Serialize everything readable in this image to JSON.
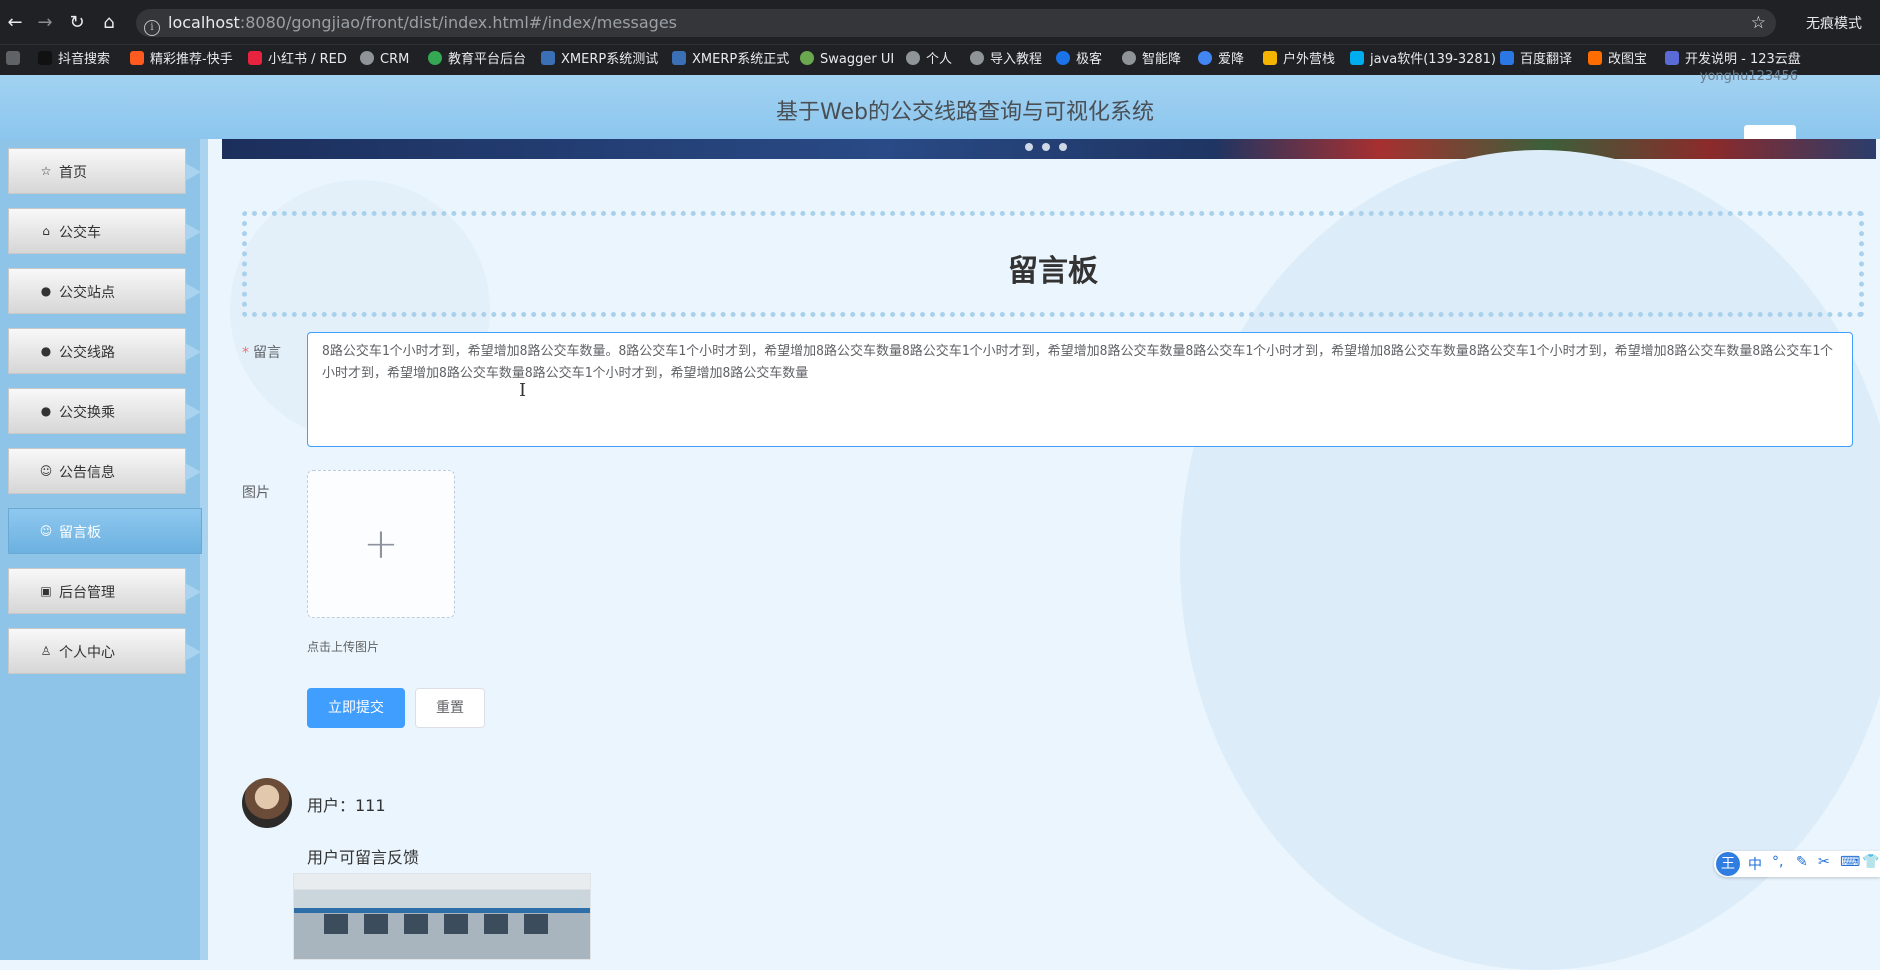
{
  "browser": {
    "url_host": "localhost",
    "url_rest": ":8080/gongjiao/front/dist/index.html#/index/messages",
    "incognito_label": "无痕模式",
    "bookmarks": [
      {
        "label": "抖音搜索",
        "color": "#111111"
      },
      {
        "label": "精彩推荐-快手",
        "color": "#ff5a1f"
      },
      {
        "label": "小红书 / RED",
        "color": "#e8233f"
      },
      {
        "label": "CRM",
        "color": "#5f6368"
      },
      {
        "label": "教育平台后台",
        "color": "#34a853"
      },
      {
        "label": "XMERP系统测试",
        "color": "#3b6fb6"
      },
      {
        "label": "XMERP系统正式",
        "color": "#3b6fb6"
      },
      {
        "label": "Swagger UI",
        "color": "#6aa84f"
      },
      {
        "label": "个人",
        "color": "#5f6368"
      },
      {
        "label": "导入教程",
        "color": "#5f6368"
      },
      {
        "label": "极客",
        "color": "#1a73e8"
      },
      {
        "label": "智能降",
        "color": "#5f6368"
      },
      {
        "label": "爱降",
        "color": "#4285f4"
      },
      {
        "label": "户外营栈",
        "color": "#f4b400"
      },
      {
        "label": "java软件(139-3281)",
        "color": "#00aeef"
      },
      {
        "label": "百度翻译",
        "color": "#2b78e4"
      },
      {
        "label": "改图宝",
        "color": "#ff6d00"
      },
      {
        "label": "开发说明 - 123云盘",
        "color": "#5b6bd6"
      }
    ]
  },
  "header": {
    "title": "基于Web的公交线路查询与可视化系统",
    "username": "yonghu123456"
  },
  "sidebar": {
    "items": [
      {
        "label": "首页",
        "icon": "☆"
      },
      {
        "label": "公交车",
        "icon": "⌂"
      },
      {
        "label": "公交站点",
        "icon": "●"
      },
      {
        "label": "公交线路",
        "icon": "●"
      },
      {
        "label": "公交换乘",
        "icon": "●"
      },
      {
        "label": "公告信息",
        "icon": "☺"
      },
      {
        "label": "留言板",
        "icon": "☺"
      },
      {
        "label": "后台管理",
        "icon": "▣"
      },
      {
        "label": "个人中心",
        "icon": "♙"
      }
    ],
    "active_index": 6
  },
  "board": {
    "title": "留言板",
    "message_label": "留言",
    "message_value": "8路公交车1个小时才到，希望增加8路公交车数量。8路公交车1个小时才到，希望增加8路公交车数量8路公交车1个小时才到，希望增加8路公交车数量8路公交车1个小时才到，希望增加8路公交车数量8路公交车1个小时才到，希望增加8路公交车数量8路公交车1个小时才到，希望增加8路公交车数量8路公交车1个小时才到，希望增加8路公交车数量",
    "image_label": "图片",
    "upload_tip": "点击上传图片",
    "submit_label": "立即提交",
    "reset_label": "重置"
  },
  "comments": [
    {
      "user": "用户：111",
      "content": "用户可留言反馈"
    }
  ],
  "ime": {
    "items": [
      "中",
      "°,",
      "✎",
      "✂",
      "⌨",
      "👕"
    ]
  }
}
